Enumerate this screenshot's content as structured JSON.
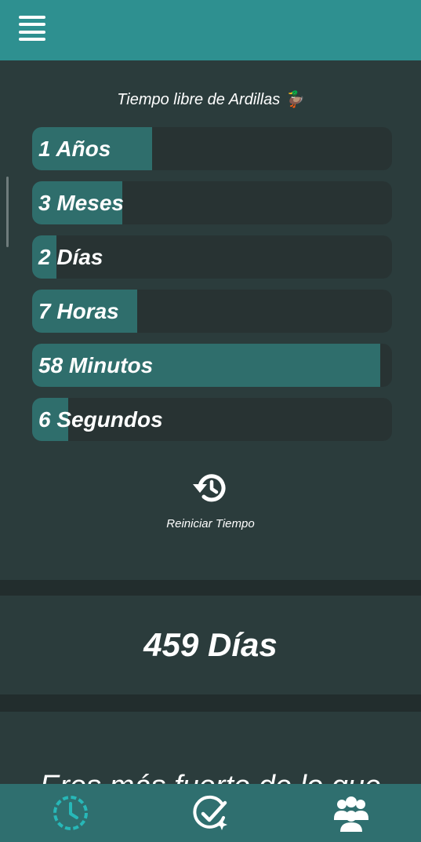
{
  "header": {
    "menu_icon": "hamburger-menu-icon"
  },
  "timer": {
    "subtitle": "Tiempo libre de Ardillas 🦆",
    "bars": [
      {
        "label": "1 Años",
        "progress": 0.333
      },
      {
        "label": "3 Meses",
        "progress": 0.25
      },
      {
        "label": "2 Días",
        "progress": 0.067
      },
      {
        "label": "7 Horas",
        "progress": 0.292
      },
      {
        "label": "58 Minutos",
        "progress": 0.967
      },
      {
        "label": "6 Segundos",
        "progress": 0.1
      }
    ],
    "reset_label": "Reiniciar Tiempo"
  },
  "total": {
    "days": "459 Días"
  },
  "quote": {
    "text": "Eres más fuerte de lo que"
  },
  "nav": {
    "items": [
      {
        "name": "timer",
        "icon": "clock-icon",
        "color": "#27b8b8",
        "active": true
      },
      {
        "name": "goals",
        "icon": "check-sparkle-icon",
        "color": "#ffffff",
        "active": false
      },
      {
        "name": "community",
        "icon": "users-icon",
        "color": "#ffffff",
        "active": false
      }
    ]
  },
  "colors": {
    "topbar": "#2e9090",
    "background": "#2b3c3c",
    "bar_track": "#283333",
    "bar_fill": "#2f6e6c",
    "bottom_nav": "#2f6f6f",
    "active_accent": "#27b8b8"
  }
}
